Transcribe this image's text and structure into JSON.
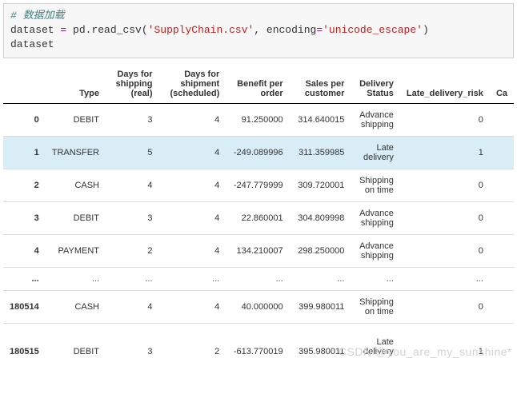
{
  "code": {
    "comment": "# 数据加载",
    "line1_a": "dataset ",
    "line1_eq": "=",
    "line1_b": " pd",
    "line1_dot1": ".",
    "line1_c": "read_csv(",
    "line1_str1": "'SupplyChain.csv'",
    "line1_d": ", encoding",
    "line1_eq2": "=",
    "line1_str2": "'unicode_escape'",
    "line1_e": ")",
    "line2": "dataset"
  },
  "headers": {
    "idx": "",
    "c0": "Type",
    "c1": "Days for shipping (real)",
    "c2": "Days for shipment (scheduled)",
    "c3": "Benefit per order",
    "c4": "Sales per customer",
    "c5": "Delivery Status",
    "c6": "Late_delivery_risk",
    "c7": "Ca"
  },
  "rows": [
    {
      "idx": "0",
      "c0": "DEBIT",
      "c1": "3",
      "c2": "4",
      "c3": "91.250000",
      "c4": "314.640015",
      "c5": "Advance shipping",
      "c6": "0",
      "c7": ""
    },
    {
      "idx": "1",
      "c0": "TRANSFER",
      "c1": "5",
      "c2": "4",
      "c3": "-249.089996",
      "c4": "311.359985",
      "c5": "Late delivery",
      "c6": "1",
      "c7": ""
    },
    {
      "idx": "2",
      "c0": "CASH",
      "c1": "4",
      "c2": "4",
      "c3": "-247.779999",
      "c4": "309.720001",
      "c5": "Shipping on time",
      "c6": "0",
      "c7": ""
    },
    {
      "idx": "3",
      "c0": "DEBIT",
      "c1": "3",
      "c2": "4",
      "c3": "22.860001",
      "c4": "304.809998",
      "c5": "Advance shipping",
      "c6": "0",
      "c7": ""
    },
    {
      "idx": "4",
      "c0": "PAYMENT",
      "c1": "2",
      "c2": "4",
      "c3": "134.210007",
      "c4": "298.250000",
      "c5": "Advance shipping",
      "c6": "0",
      "c7": ""
    }
  ],
  "ellipsis": {
    "idx": "...",
    "c0": "...",
    "c1": "...",
    "c2": "...",
    "c3": "...",
    "c4": "...",
    "c5": "...",
    "c6": "...",
    "c7": ""
  },
  "tail": [
    {
      "idx": "180514",
      "c0": "CASH",
      "c1": "4",
      "c2": "4",
      "c3": "40.000000",
      "c4": "399.980011",
      "c5": "Shipping on time",
      "c6": "0",
      "c7": ""
    },
    {
      "idx": "180515",
      "c0": "DEBIT",
      "c1": "3",
      "c2": "2",
      "c3": "-613.770019",
      "c4": "395.980011",
      "c5": "Late delivery",
      "c6": "1",
      "c7": ""
    }
  ],
  "watermark": "CSDN @you_are_my_sunshine*"
}
